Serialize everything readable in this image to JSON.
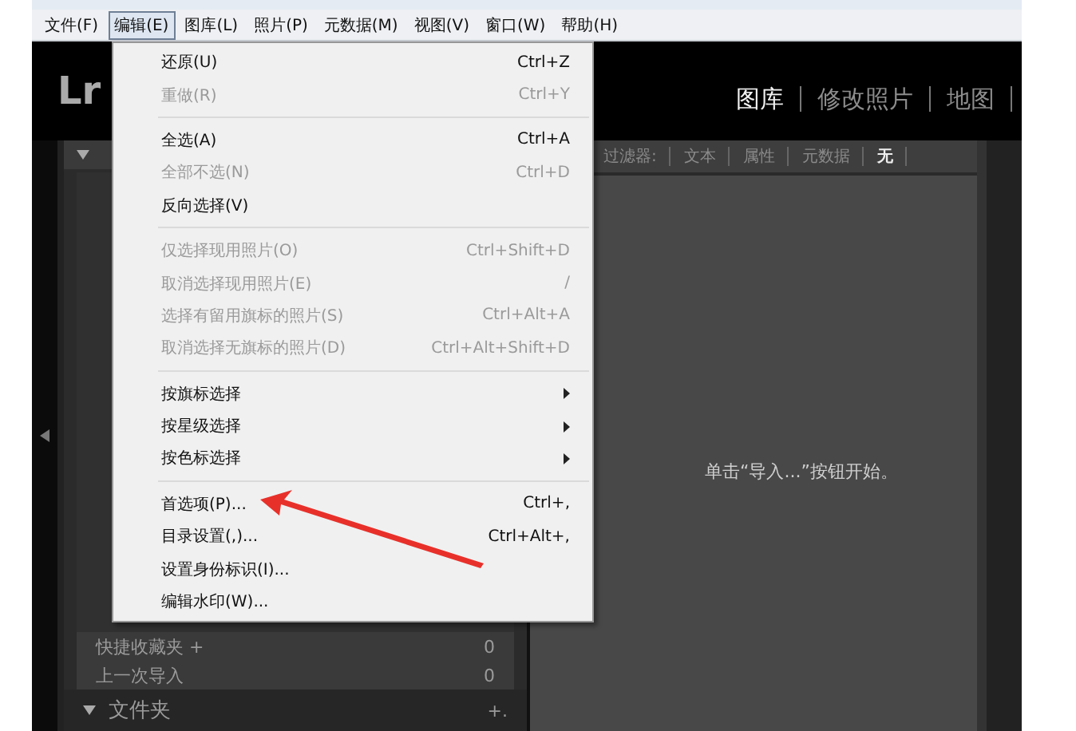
{
  "menu_bar": [
    {
      "label": "文件(F)",
      "selected": false
    },
    {
      "label": "编辑(E)",
      "selected": true
    },
    {
      "label": "图库(L)",
      "selected": false
    },
    {
      "label": "照片(P)",
      "selected": false
    },
    {
      "label": "元数据(M)",
      "selected": false
    },
    {
      "label": "视图(V)",
      "selected": false
    },
    {
      "label": "窗口(W)",
      "selected": false
    },
    {
      "label": "帮助(H)",
      "selected": false
    }
  ],
  "logo": "Lr",
  "module_tabs": [
    {
      "label": "图库",
      "selected": true
    },
    {
      "label": "修改照片",
      "selected": false
    },
    {
      "label": "地图",
      "selected": false
    }
  ],
  "filter_bar": {
    "label": "过滤器:",
    "options": [
      {
        "label": "文本",
        "selected": false
      },
      {
        "label": "属性",
        "selected": false
      },
      {
        "label": "元数据",
        "selected": false
      },
      {
        "label": "无",
        "selected": true
      }
    ]
  },
  "left_panel": {
    "collections": [
      {
        "label": "快捷收藏夹 +",
        "count": "0"
      },
      {
        "label": "上一次导入",
        "count": "0"
      }
    ],
    "folders": {
      "label": "文件夹",
      "action": "+."
    }
  },
  "center": {
    "message": "单击“导入...”按钮开始。"
  },
  "edit_menu": [
    {
      "kind": "item",
      "label": "还原(U)",
      "shortcut": "Ctrl+Z",
      "disabled": false,
      "submenu": false
    },
    {
      "kind": "item",
      "label": "重做(R)",
      "shortcut": "Ctrl+Y",
      "disabled": true,
      "submenu": false
    },
    {
      "kind": "separator"
    },
    {
      "kind": "item",
      "label": "全选(A)",
      "shortcut": "Ctrl+A",
      "disabled": false,
      "submenu": false
    },
    {
      "kind": "item",
      "label": "全部不选(N)",
      "shortcut": "Ctrl+D",
      "disabled": true,
      "submenu": false
    },
    {
      "kind": "item",
      "label": "反向选择(V)",
      "disabled": false,
      "submenu": false
    },
    {
      "kind": "separator"
    },
    {
      "kind": "item",
      "label": "仅选择现用照片(O)",
      "shortcut": "Ctrl+Shift+D",
      "disabled": true,
      "submenu": false
    },
    {
      "kind": "item",
      "label": "取消选择现用照片(E)",
      "shortcut": "/",
      "disabled": true,
      "submenu": false
    },
    {
      "kind": "item",
      "label": "选择有留用旗标的照片(S)",
      "shortcut": "Ctrl+Alt+A",
      "disabled": true,
      "submenu": false
    },
    {
      "kind": "item",
      "label": "取消选择无旗标的照片(D)",
      "shortcut": "Ctrl+Alt+Shift+D",
      "disabled": true,
      "submenu": false
    },
    {
      "kind": "separator"
    },
    {
      "kind": "item",
      "label": "按旗标选择",
      "disabled": false,
      "submenu": true
    },
    {
      "kind": "item",
      "label": "按星级选择",
      "disabled": false,
      "submenu": true
    },
    {
      "kind": "item",
      "label": "按色标选择",
      "disabled": false,
      "submenu": true
    },
    {
      "kind": "separator"
    },
    {
      "kind": "item",
      "label": "首选项(P)...",
      "shortcut": "Ctrl+,",
      "disabled": false,
      "submenu": false
    },
    {
      "kind": "item",
      "label": "目录设置(,)...",
      "shortcut": "Ctrl+Alt+,",
      "disabled": false,
      "submenu": false
    },
    {
      "kind": "item",
      "label": "设置身份标识(I)...",
      "disabled": false,
      "submenu": false
    },
    {
      "kind": "item",
      "label": "编辑水印(W)...",
      "disabled": false,
      "submenu": false
    }
  ]
}
